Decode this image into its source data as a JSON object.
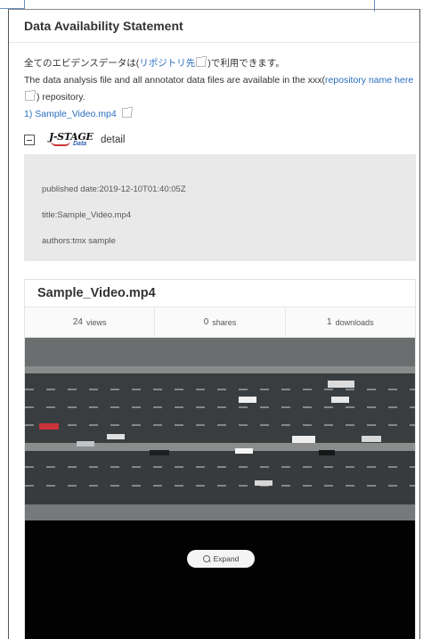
{
  "header": {
    "title": "Data Availability Statement"
  },
  "statement": {
    "jp_prefix": "全てのエビデンスデータは(",
    "jp_link": "リポジトリ先",
    "jp_suffix": ")で利用できます。",
    "en_prefix": "The data analysis file and all annotator data files are available in the xxx(",
    "en_link": "repository name here",
    "en_suffix": ") repository."
  },
  "file": {
    "link_label": "1) Sample_Video.mp4"
  },
  "detail": {
    "logo_text": "J-STAGE",
    "logo_sub": "Data",
    "label": "detail"
  },
  "meta": {
    "published": "published date:2019-12-10T01:40:05Z",
    "title": "title:Sample_Video.mp4",
    "authors": "authors:tmx sample"
  },
  "card": {
    "title": "Sample_Video.mp4",
    "stats": [
      {
        "value": "24",
        "label": "views"
      },
      {
        "value": "0",
        "label": "shares"
      },
      {
        "value": "1",
        "label": "downloads"
      }
    ],
    "expand_label": "Expand"
  },
  "colors": {
    "link": "#2a6ebf",
    "meta_bg": "#e9e9e9",
    "video_bg": "#020202"
  }
}
